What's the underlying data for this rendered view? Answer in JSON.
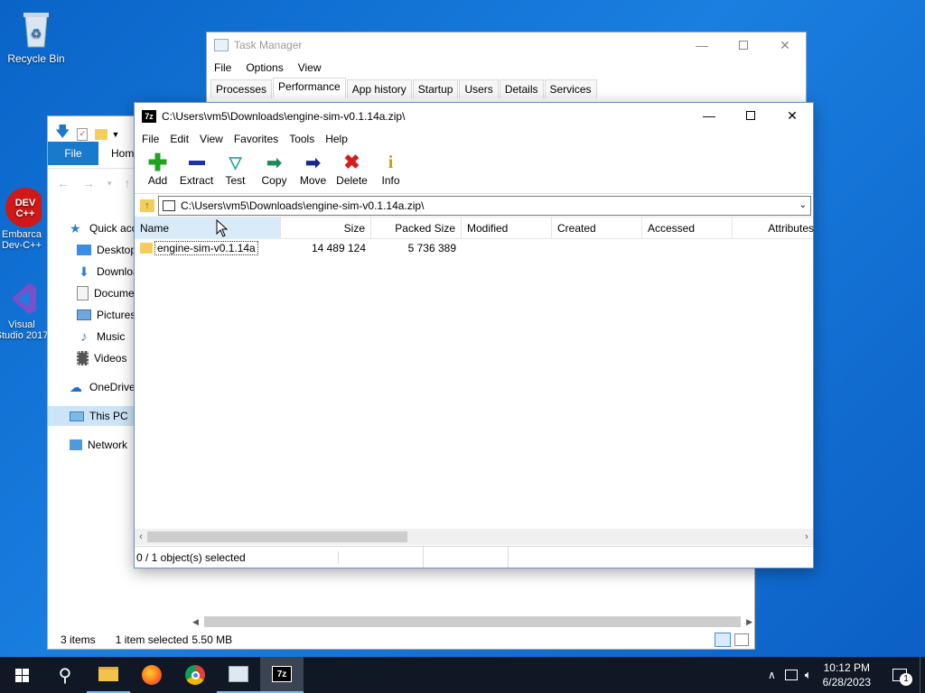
{
  "desktop": {
    "icons": [
      {
        "label": "Recycle Bin",
        "icon": "recycle-bin-icon"
      },
      {
        "label": "Embarca Dev-C++",
        "icon": "devcpp-icon"
      },
      {
        "label": "Visual Studio 2017",
        "icon": "visual-studio-icon"
      }
    ]
  },
  "task_manager": {
    "title": "Task Manager",
    "menu": [
      "File",
      "Options",
      "View"
    ],
    "tabs": [
      "Processes",
      "Performance",
      "App history",
      "Startup",
      "Users",
      "Details",
      "Services"
    ],
    "active_tab": "Performance"
  },
  "explorer": {
    "ribbon_tabs": [
      "File",
      "Home"
    ],
    "nav": [
      {
        "label": "Quick access",
        "icon": "star-icon"
      },
      {
        "label": "Desktop",
        "icon": "desktop-icon"
      },
      {
        "label": "Downloads",
        "icon": "download-icon"
      },
      {
        "label": "Documents",
        "icon": "documents-icon"
      },
      {
        "label": "Pictures",
        "icon": "pictures-icon"
      },
      {
        "label": "Music",
        "icon": "music-icon"
      },
      {
        "label": "Videos",
        "icon": "videos-icon"
      },
      {
        "label": "OneDrive",
        "icon": "cloud-icon"
      },
      {
        "label": "This PC",
        "icon": "computer-icon"
      },
      {
        "label": "Network",
        "icon": "network-icon"
      }
    ],
    "status": {
      "items": "3 items",
      "selected": "1 item selected",
      "size": "5.50 MB"
    }
  },
  "sevenzip": {
    "title": "C:\\Users\\vm5\\Downloads\\engine-sim-v0.1.14a.zip\\",
    "menu": [
      "File",
      "Edit",
      "View",
      "Favorites",
      "Tools",
      "Help"
    ],
    "toolbar": [
      {
        "label": "Add",
        "icon": "add-icon",
        "color": "#1fa31f"
      },
      {
        "label": "Extract",
        "icon": "extract-icon",
        "color": "#1e2fb0"
      },
      {
        "label": "Test",
        "icon": "test-icon",
        "color": "#21a3a3"
      },
      {
        "label": "Copy",
        "icon": "copy-icon",
        "color": "#1d8a5a"
      },
      {
        "label": "Move",
        "icon": "move-icon",
        "color": "#142a8c"
      },
      {
        "label": "Delete",
        "icon": "delete-icon",
        "color": "#d81b1b"
      },
      {
        "label": "Info",
        "icon": "info-icon",
        "color": "#c9a100"
      }
    ],
    "address": "C:\\Users\\vm5\\Downloads\\engine-sim-v0.1.14a.zip\\",
    "columns": [
      "Name",
      "Size",
      "Packed Size",
      "Modified",
      "Created",
      "Accessed",
      "Attributes"
    ],
    "rows": [
      {
        "name": "engine-sim-v0.1.14a",
        "size": "14 489 124",
        "packed": "5 736 389",
        "modified": "",
        "created": "",
        "accessed": "",
        "attributes": ""
      }
    ],
    "status": "0 / 1 object(s) selected"
  },
  "taskbar": {
    "time": "10:12 PM",
    "date": "6/28/2023",
    "notifications": "1",
    "apps": [
      "windows-start-icon",
      "search-icon",
      "file-explorer-icon",
      "firefox-icon",
      "chrome-icon",
      "task-manager-icon",
      "sevenzip-icon"
    ]
  }
}
